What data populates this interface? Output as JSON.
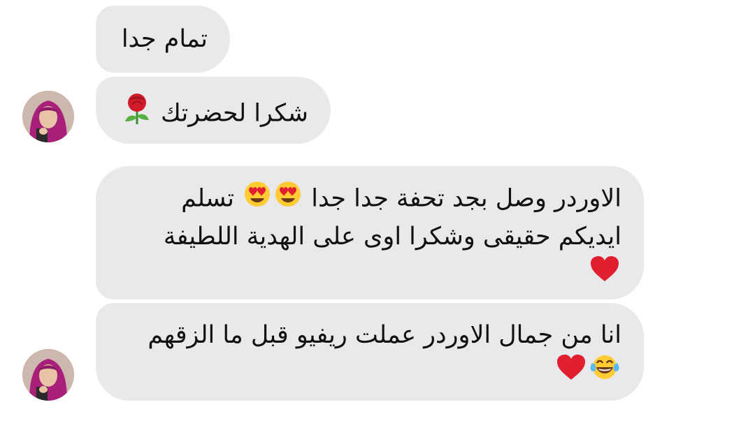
{
  "messages": [
    {
      "text": "تمام جدا",
      "emojis": []
    },
    {
      "text": "شكرا لحضرتك",
      "emojis": [
        "rose-icon"
      ]
    },
    {
      "text": "الاوردر وصل بجد تحفة جدا جدا",
      "text2": "تسلم ايديكم حقيقى وشكرا اوى على الهدية اللطيفة",
      "emojis": [
        "heart-eyes-icon",
        "heart-eyes-icon",
        "red-heart-icon"
      ]
    },
    {
      "text": "انا من جمال الاوردر عملت ريفيو قبل ما الزقهم",
      "emojis": [
        "tears-of-joy-icon",
        "red-heart-icon"
      ]
    }
  ],
  "colors": {
    "bubble": "#e9e9eb",
    "text": "#111111",
    "heart": "#e0202e",
    "emoji_face": "#ffcc33",
    "avatar_hijab": "#a8207a"
  }
}
